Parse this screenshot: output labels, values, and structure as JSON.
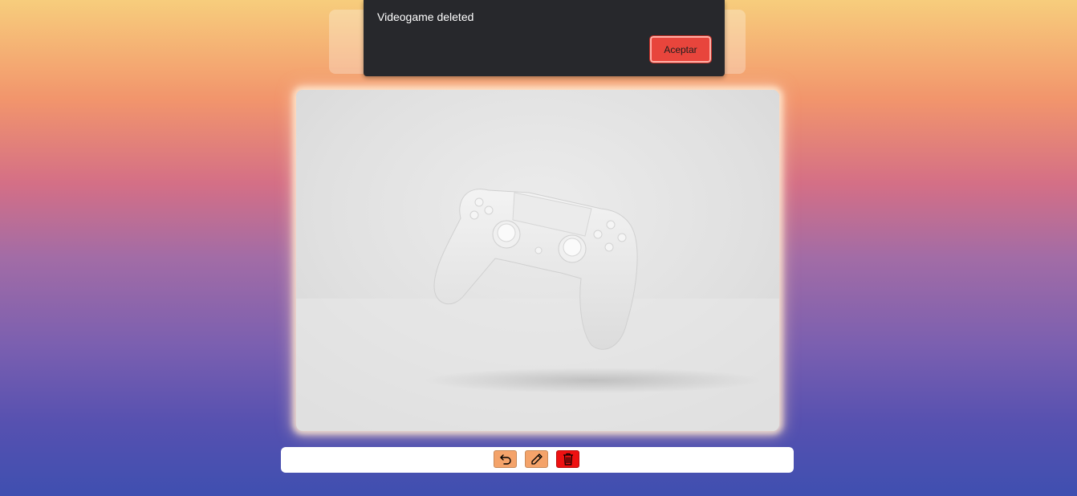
{
  "dialog": {
    "message": "Videogame deleted",
    "confirm_label": "Aceptar"
  },
  "image": {
    "subject": "white game controller"
  },
  "toolbar": {
    "buttons": [
      {
        "name": "back",
        "icon": "undo-arrow-icon",
        "color": "#f4a36a"
      },
      {
        "name": "edit",
        "icon": "pencil-icon",
        "color": "#f4a36a"
      },
      {
        "name": "delete",
        "icon": "trash-icon",
        "color": "#ee1111"
      }
    ]
  }
}
